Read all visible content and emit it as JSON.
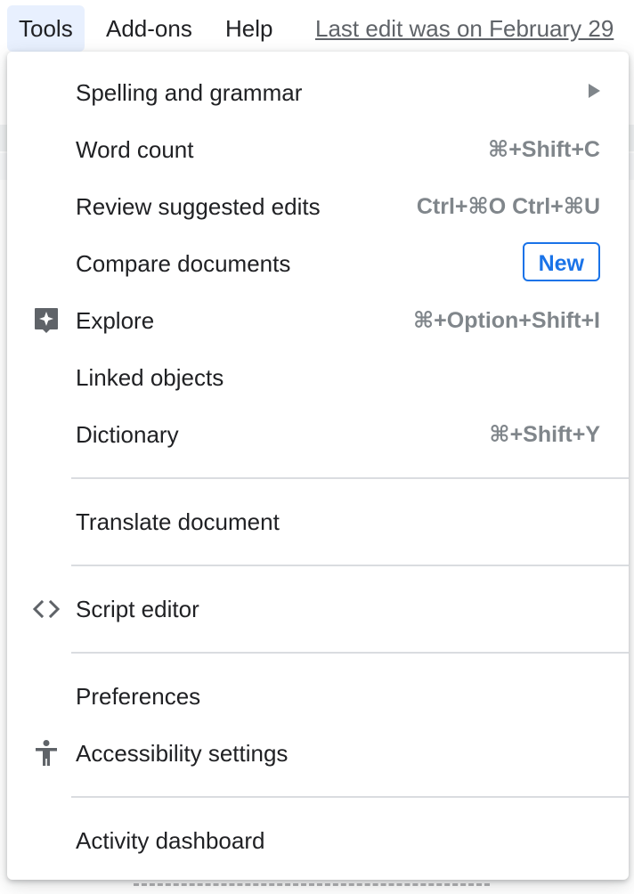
{
  "menubar": {
    "tools": "Tools",
    "addons": "Add-ons",
    "help": "Help",
    "last_edit": "Last edit was on February 29"
  },
  "tools_menu": {
    "items": [
      {
        "label": "Spelling and grammar",
        "shortcut": "",
        "icon": "",
        "has_submenu": true
      },
      {
        "label": "Word count",
        "shortcut": "⌘+Shift+C",
        "icon": ""
      },
      {
        "label": "Review suggested edits",
        "shortcut": "Ctrl+⌘O Ctrl+⌘U",
        "icon": ""
      },
      {
        "label": "Compare documents",
        "badge": "New",
        "icon": ""
      },
      {
        "label": "Explore",
        "shortcut": "⌘+Option+Shift+I",
        "icon": "explore-sparkle-icon"
      },
      {
        "label": "Linked objects",
        "shortcut": "",
        "icon": ""
      },
      {
        "label": "Dictionary",
        "shortcut": "⌘+Shift+Y",
        "icon": ""
      },
      {
        "label": "Translate document",
        "shortcut": "",
        "icon": ""
      },
      {
        "label": "Script editor",
        "shortcut": "",
        "icon": "code-brackets-icon"
      },
      {
        "label": "Preferences",
        "shortcut": "",
        "icon": ""
      },
      {
        "label": "Accessibility settings",
        "shortcut": "",
        "icon": "accessibility-person-icon"
      },
      {
        "label": "Activity dashboard",
        "shortcut": "",
        "icon": ""
      }
    ]
  },
  "colors": {
    "accent": "#1a73e8",
    "active_menu_bg": "#e8f0fe",
    "text": "#202124",
    "muted": "#80868b",
    "divider": "#dadce0"
  }
}
